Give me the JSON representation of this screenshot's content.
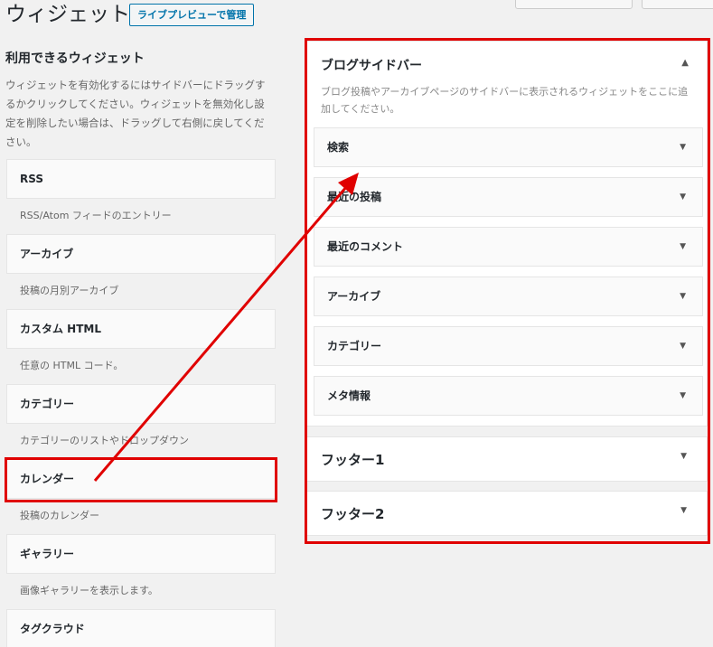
{
  "header": {
    "title": "ウィジェット",
    "live_preview_button": "ライブプレビューで管理"
  },
  "available_widgets": {
    "title": "利用できるウィジェット",
    "description": "ウィジェットを有効化するにはサイドバーにドラッグするかクリックしてください。ウィジェットを無効化し設定を削除したい場合は、ドラッグして右側に戻してください。",
    "items": [
      {
        "name": "RSS",
        "desc": "RSS/Atom フィードのエントリー"
      },
      {
        "name": "アーカイブ",
        "desc": "投稿の月別アーカイブ"
      },
      {
        "name": "カスタム HTML",
        "desc": "任意の HTML コード。"
      },
      {
        "name": "カテゴリー",
        "desc": "カテゴリーのリストやドロップダウン"
      },
      {
        "name": "カレンダー",
        "desc": "投稿のカレンダー"
      },
      {
        "name": "ギャラリー",
        "desc": "画像ギャラリーを表示します。"
      },
      {
        "name": "タグクラウド",
        "desc": ""
      }
    ]
  },
  "widget_areas": {
    "blog_sidebar": {
      "title": "ブログサイドバー",
      "description": "ブログ投稿やアーカイブページのサイドバーに表示されるウィジェットをここに追加してください。",
      "collapse_icon": "▲",
      "widgets": [
        "検索",
        "最近の投稿",
        "最近のコメント",
        "アーカイブ",
        "カテゴリー",
        "メタ情報"
      ]
    },
    "footer1": {
      "title": "フッター1"
    },
    "footer2": {
      "title": "フッター2"
    },
    "expand_icon": "▼"
  },
  "annotation": {
    "color": "#e00000"
  }
}
